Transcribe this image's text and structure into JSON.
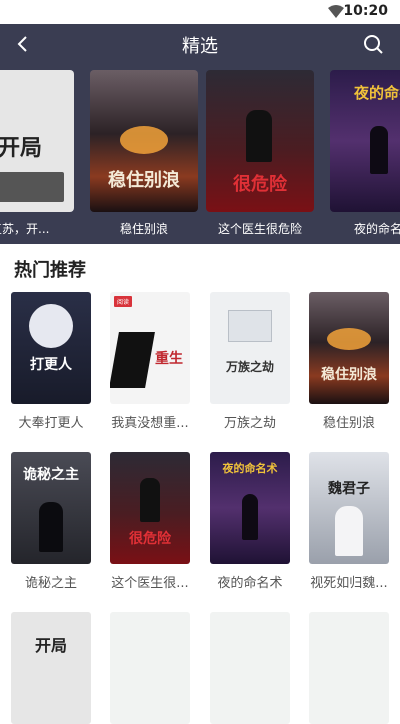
{
  "status_bar": {
    "time": "10:20",
    "wifi_icon": "wifi-icon"
  },
  "header": {
    "title": "精选",
    "back_icon": "back-arrow-icon",
    "search_icon": "search-icon",
    "bg_color": "#3a3d52"
  },
  "banner": [
    {
      "caption": "灵气复苏，开...",
      "cover_text": "开局",
      "cover_color": "#e8e8e8"
    },
    {
      "caption": "稳住别浪",
      "cover_text": "稳住别浪",
      "cover_color": "#2c2226"
    },
    {
      "caption": "这个医生很危险",
      "cover_text": "很危险",
      "cover_color": "#3b1419"
    },
    {
      "caption": "夜的命名术",
      "cover_text": "夜的命名",
      "cover_color": "#3a1c55"
    }
  ],
  "section": {
    "title": "热门推荐"
  },
  "books": [
    {
      "title": "大奉打更人",
      "cover_text": "打更人",
      "cover_color": "#1f2233"
    },
    {
      "title": "我真没想重...",
      "cover_text": "重生",
      "cover_color": "#f2f2f2"
    },
    {
      "title": "万族之劫",
      "cover_text": "万族之劫",
      "cover_color": "#eef0f2"
    },
    {
      "title": "稳住别浪",
      "cover_text": "稳住别浪",
      "cover_color": "#2c2226"
    },
    {
      "title": "诡秘之主",
      "cover_text": "诡秘之主",
      "cover_color": "#2f3036"
    },
    {
      "title": "这个医生很...",
      "cover_text": "很危险",
      "cover_color": "#3b1419"
    },
    {
      "title": "夜的命名术",
      "cover_text": "夜的命名术",
      "cover_color": "#3a1c55"
    },
    {
      "title": "视死如归魏...",
      "cover_text": "魏君子",
      "cover_color": "#c9ccd4"
    }
  ]
}
